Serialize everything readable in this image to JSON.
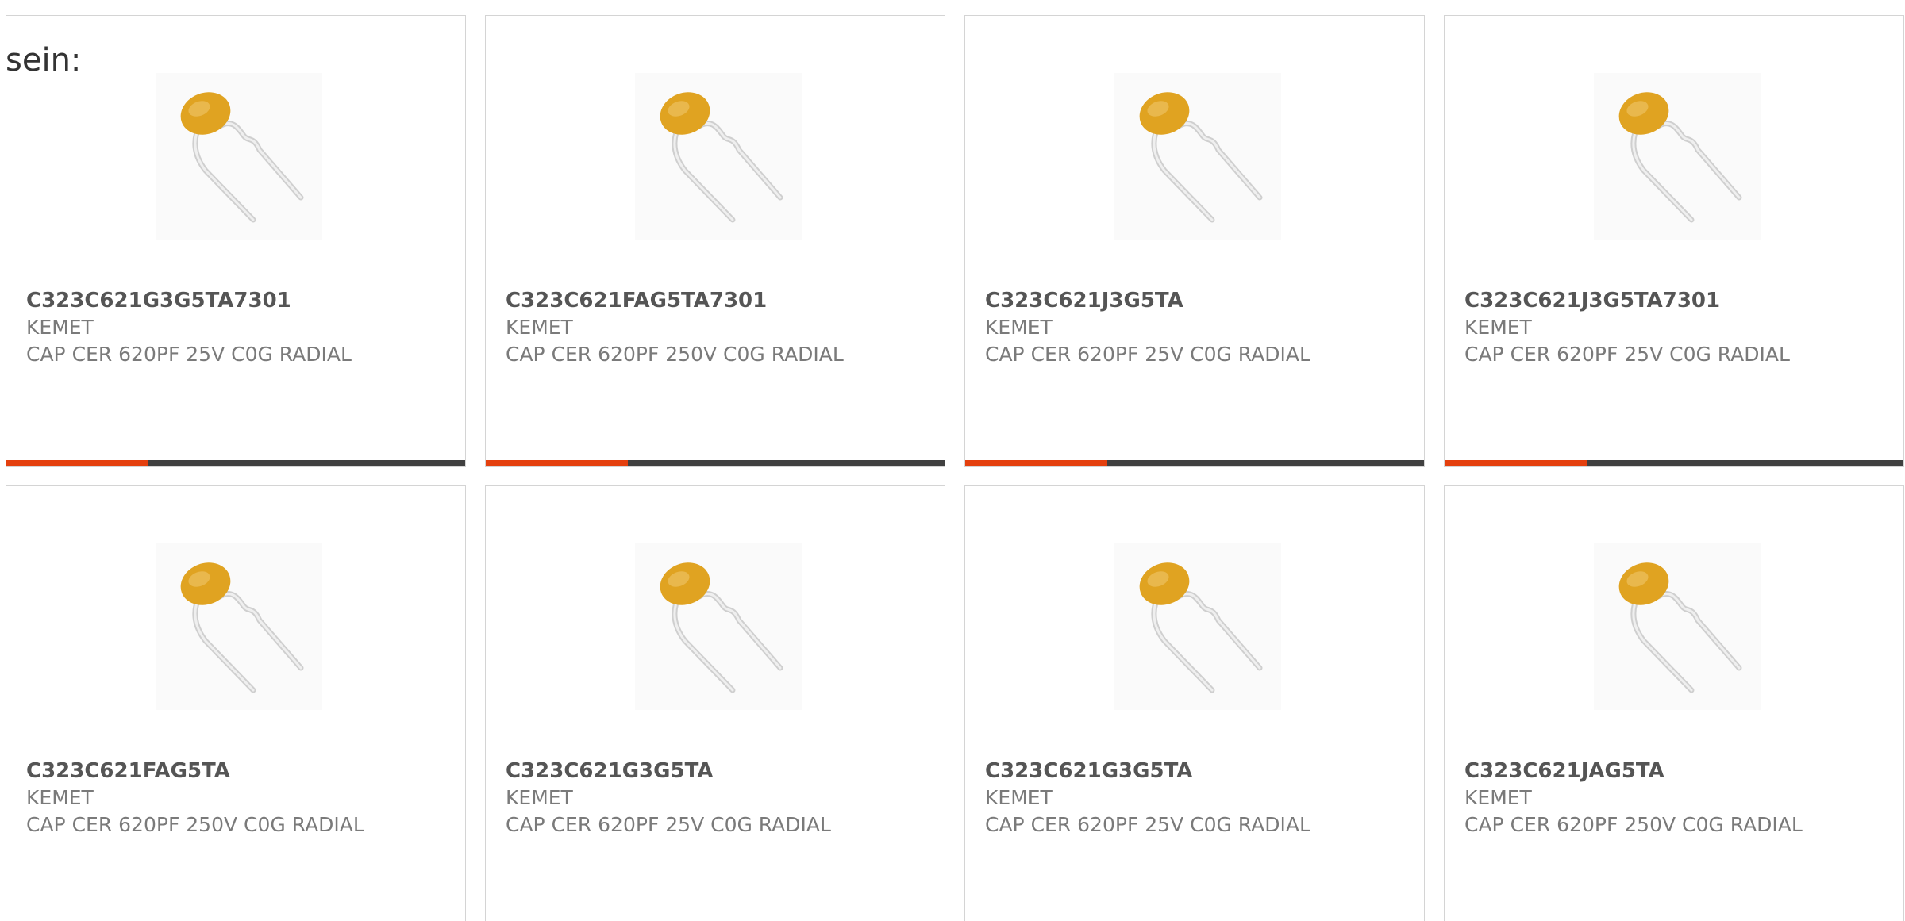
{
  "intro_text": "sein:",
  "colors": {
    "accent": "#e4400e",
    "track": "#404040",
    "capacitor_body": "#e0a321",
    "lead": "#d8d8d8"
  },
  "product_icon": "ceramic-capacitor-icon",
  "products": [
    {
      "part_number": "C323C621G3G5TA7301",
      "manufacturer": "KEMET",
      "description": "CAP CER 620PF 25V C0G RADIAL",
      "progress": 0.31
    },
    {
      "part_number": "C323C621FAG5TA7301",
      "manufacturer": "KEMET",
      "description": "CAP CER 620PF 250V C0G RADIAL",
      "progress": 0.31
    },
    {
      "part_number": "C323C621J3G5TA",
      "manufacturer": "KEMET",
      "description": "CAP CER 620PF 25V C0G RADIAL",
      "progress": 0.31
    },
    {
      "part_number": "C323C621J3G5TA7301",
      "manufacturer": "KEMET",
      "description": "CAP CER 620PF 25V C0G RADIAL",
      "progress": 0.31
    },
    {
      "part_number": "C323C621FAG5TA",
      "manufacturer": "KEMET",
      "description": "CAP CER 620PF 250V C0G RADIAL",
      "progress": null
    },
    {
      "part_number": "C323C621G3G5TA",
      "manufacturer": "KEMET",
      "description": "CAP CER 620PF 25V C0G RADIAL",
      "progress": null
    },
    {
      "part_number": "C323C621G3G5TA",
      "manufacturer": "KEMET",
      "description": "CAP CER 620PF 25V C0G RADIAL",
      "progress": null
    },
    {
      "part_number": "C323C621JAG5TA",
      "manufacturer": "KEMET",
      "description": "CAP CER 620PF 250V C0G RADIAL",
      "progress": null
    }
  ]
}
